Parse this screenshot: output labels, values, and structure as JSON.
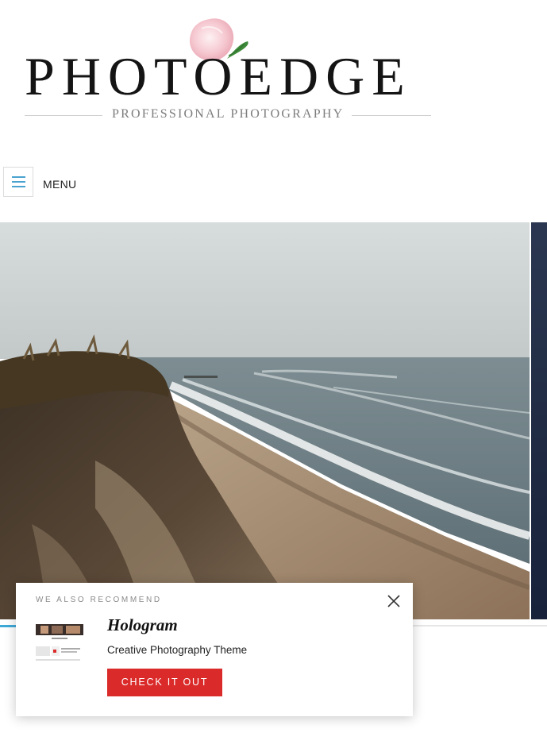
{
  "brand": {
    "title": "PHOTOEDGE",
    "subtitle": "PROFESSIONAL PHOTOGRAPHY",
    "logo_petal_icon": "rose-petal-icon"
  },
  "nav": {
    "menu_icon": "hamburger-icon",
    "menu_label": "MENU"
  },
  "hero": {
    "image": "coastal-cliff-beach-photo",
    "next_image": "dark-night-photo",
    "progress_fraction": 0.03
  },
  "recommend": {
    "kicker": "WE ALSO RECOMMEND",
    "title": "Hologram",
    "description": "Creative Photography Theme",
    "cta_label": "CHECK IT OUT",
    "close_icon": "close-icon",
    "thumb_icon": "theme-preview-thumbnail"
  },
  "colors": {
    "accent": "#3fa9d8",
    "cta": "#db2a2a",
    "menu_bars": "#4aa3cf"
  }
}
